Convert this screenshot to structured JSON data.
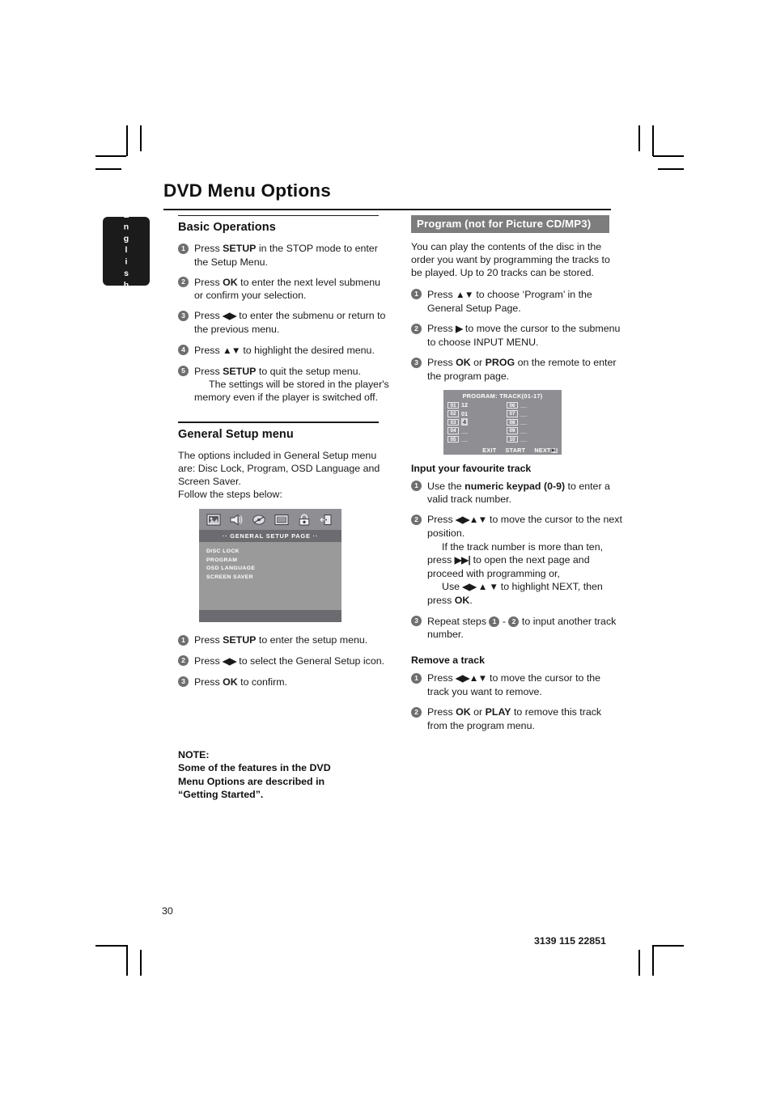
{
  "document": {
    "title": "DVD Menu Options",
    "language_tab": "English",
    "page_number": "30",
    "doc_code": "3139 115 22851"
  },
  "left_column": {
    "basic_operations": {
      "heading": "Basic Operations",
      "steps": [
        {
          "num": "1",
          "html": "Press <b>SETUP</b> in the STOP mode to enter the Setup Menu."
        },
        {
          "num": "2",
          "html": "Press <b>OK</b> to enter the next level submenu or confirm your selection."
        },
        {
          "num": "3",
          "html": "Press ◀▶ to enter the submenu or return to the previous menu."
        },
        {
          "num": "4",
          "html": "Press ▲▼ to highlight the desired menu."
        },
        {
          "num": "5",
          "html": "Press <b>SETUP</b> to quit the setup menu. The settings will be stored in the player's memory even if the player is switched off."
        }
      ],
      "step1_text": "Press SETUP in the STOP mode to enter the Setup Menu.",
      "step2_text": "Press OK to enter the next level submenu or confirm your selection.",
      "step3_text": "Press ◀▶ to enter the submenu or return to the previous menu.",
      "step4_text": "Press ▲▼ to highlight the desired menu.",
      "step5_text": "Press SETUP to quit the setup menu.",
      "step5_extra": "The settings will be stored in the player's memory even if the player is switched off."
    },
    "general_setup": {
      "heading": "General Setup menu",
      "intro": "The options included in General Setup menu are: Disc Lock, Program, OSD Language and Screen Saver.",
      "intro_line2": "Follow the steps below:",
      "steps": [
        {
          "num": "1",
          "text": "Press SETUP to enter the setup menu."
        },
        {
          "num": "2",
          "text": "Press ◀▶ to select the General Setup icon."
        },
        {
          "num": "3",
          "text": "Press OK to confirm."
        }
      ]
    },
    "osd_general": {
      "icons": [
        "picture-icon",
        "speaker-icon",
        "audio-disc-icon",
        "video-screen-icon",
        "lock-icon",
        "exit-door-icon"
      ],
      "page_title": "··  GENERAL  SETUP  PAGE  ··",
      "menu_items": [
        "DISC LOCK",
        "PROGRAM",
        "OSD LANGUAGE",
        "SCREEN SAVER"
      ]
    },
    "note": {
      "label": "NOTE:",
      "line1": "Some of the features in the DVD",
      "line2": "Menu Options are described in",
      "line3": "“Getting Started”."
    }
  },
  "right_column": {
    "program": {
      "band_title": "Program (not for Picture CD/MP3)",
      "intro": "You can play the contents of the disc in the order you want by programming the tracks to be played. Up to 20 tracks can be stored.",
      "steps": [
        {
          "num": "1",
          "text": "Press ▲▼ to choose ‘Program’ in the General Setup Page."
        },
        {
          "num": "2",
          "text": "Press ▶ to move the cursor to the submenu to choose INPUT MENU."
        },
        {
          "num": "3",
          "text": "Press OK or PROG on the remote to enter the program page."
        }
      ]
    },
    "osd_program": {
      "title": "PROGRAM:  TRACK(01-17)",
      "left_slots": [
        {
          "slot": "01",
          "value": "12",
          "selected": false
        },
        {
          "slot": "02",
          "value": "01",
          "selected": false
        },
        {
          "slot": "03",
          "value": "4",
          "selected": true
        },
        {
          "slot": "04",
          "value": "__",
          "selected": false
        },
        {
          "slot": "05",
          "value": "__",
          "selected": false
        }
      ],
      "right_slots": [
        {
          "slot": "06",
          "value": "__",
          "selected": false
        },
        {
          "slot": "07",
          "value": "__",
          "selected": false
        },
        {
          "slot": "08",
          "value": "__",
          "selected": false
        },
        {
          "slot": "09",
          "value": "__",
          "selected": false
        },
        {
          "slot": "10",
          "value": "__",
          "selected": false
        }
      ],
      "footer": [
        "EXIT",
        "START",
        "NEXT"
      ],
      "next_badge": "▶▶|"
    },
    "input_track": {
      "heading": "Input your favourite track",
      "step1_pre": "Use the ",
      "step1_bold": "numeric keypad (0-9)",
      "step1_post": " to enter a valid track number.",
      "step2_text": "Press ◀▶▲▼ to move the cursor to the next position.",
      "step2_extra1": "If the track number is more than ten, press ▶▶| to open the next page and proceed with programming or,",
      "step2_extra2": "Use ◀▶ ▲ ▼ to highlight NEXT, then press OK.",
      "step3_pre": "Repeat steps ",
      "step3_mid": " - ",
      "step3_post": " to input another track number."
    },
    "remove_track": {
      "heading": "Remove a track",
      "step1_text": "Press ◀▶▲▼ to move the cursor to the track you want to remove.",
      "step2_text": "Press OK or PLAY to remove this track from the program menu."
    }
  },
  "colors": {
    "band_gray": "#7d7d7d",
    "bullet_gray": "#6e6e6e",
    "tab_black": "#1b1b1b",
    "osd_gray": "#9a9a9a"
  }
}
